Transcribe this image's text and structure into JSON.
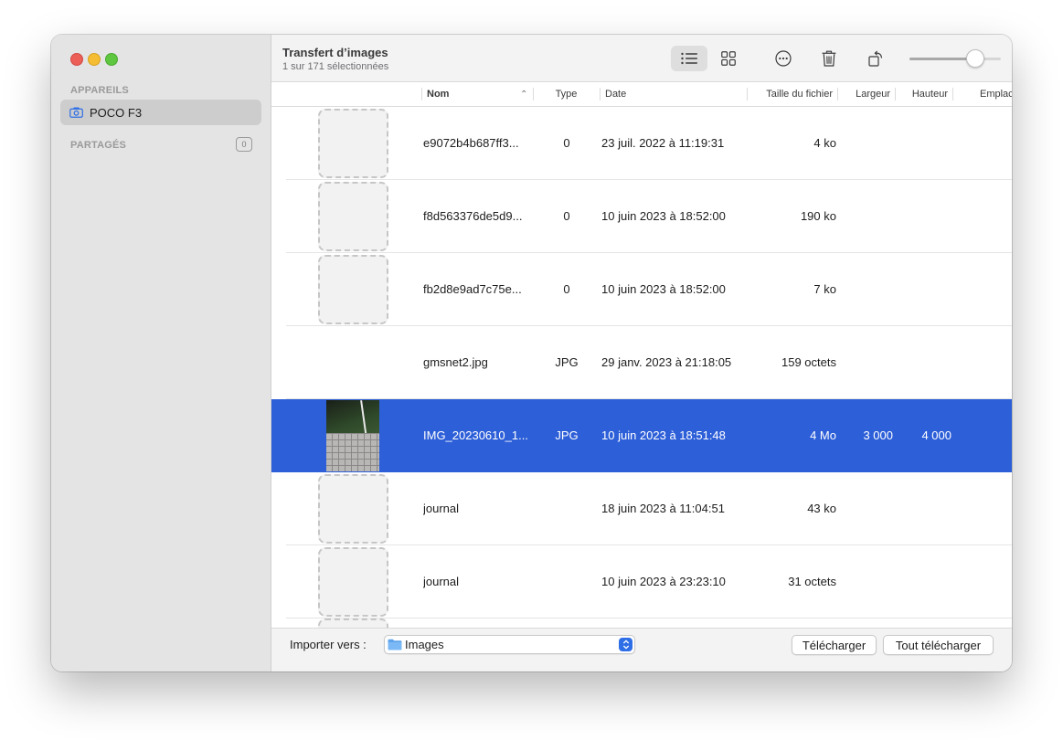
{
  "window": {
    "title": "Transfert d’images",
    "subtitle": "1 sur 171 sélectionnées"
  },
  "sidebar": {
    "devices_heading": "APPAREILS",
    "device_name": "POCO F3",
    "shared_heading": "PARTAGÉS",
    "shared_count": "0"
  },
  "toolbar": {
    "icons": [
      "list-view-icon",
      "grid-view-icon",
      "more-options-icon",
      "trash-icon",
      "rotate-icon"
    ],
    "thumbnail_size_fraction": 0.78
  },
  "table": {
    "columns": {
      "name": "Nom",
      "type": "Type",
      "date": "Date",
      "size": "Taille du fichier",
      "width": "Largeur",
      "height": "Hauteur",
      "location": "Emplac"
    },
    "rows": [
      {
        "name": "e9072b4b687ff3...",
        "type": "0",
        "date": "23 juil. 2022 à 11:19:31",
        "size": "4 ko",
        "width": "",
        "height": "",
        "thumb": "placeholder"
      },
      {
        "name": "f8d563376de5d9...",
        "type": "0",
        "date": "10 juin 2023 à 18:52:00",
        "size": "190 ko",
        "width": "",
        "height": "",
        "thumb": "placeholder"
      },
      {
        "name": "fb2d8e9ad7c75e...",
        "type": "0",
        "date": "10 juin 2023 à 18:52:00",
        "size": "7 ko",
        "width": "",
        "height": "",
        "thumb": "placeholder"
      },
      {
        "name": "gmsnet2.jpg",
        "type": "JPG",
        "date": "29 janv. 2023 à 21:18:05",
        "size": "159 octets",
        "width": "",
        "height": "",
        "thumb": "none"
      },
      {
        "name": "IMG_20230610_1...",
        "type": "JPG",
        "date": "10 juin 2023 à 18:51:48",
        "size": "4 Mo",
        "width": "3 000",
        "height": "4 000",
        "thumb": "photo",
        "selected": true
      },
      {
        "name": "journal",
        "type": "",
        "date": "18 juin 2023 à 11:04:51",
        "size": "43 ko",
        "width": "",
        "height": "",
        "thumb": "placeholder"
      },
      {
        "name": "journal",
        "type": "",
        "date": "10 juin 2023 à 23:23:10",
        "size": "31 octets",
        "width": "",
        "height": "",
        "thumb": "placeholder"
      }
    ]
  },
  "bottombar": {
    "import_label": "Importer vers :",
    "destination": "Images",
    "download_button": "Télécharger",
    "download_all_button": "Tout télécharger"
  },
  "colors": {
    "selection": "#2d5fd8",
    "accent": "#2e6ee6"
  }
}
